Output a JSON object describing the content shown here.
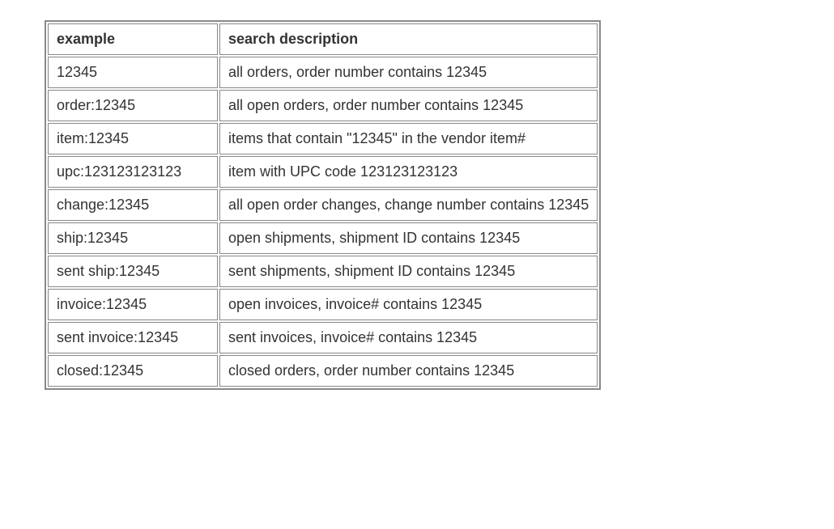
{
  "table": {
    "headers": {
      "example": "example",
      "description": "search description"
    },
    "rows": [
      {
        "example": "12345",
        "description": "all orders, order number contains 12345"
      },
      {
        "example": "order:12345",
        "description": "all open orders, order number contains 12345"
      },
      {
        "example": "item:12345",
        "description": "items that contain \"12345\" in the vendor item#"
      },
      {
        "example": "upc:123123123123",
        "description": "item with UPC code 123123123123"
      },
      {
        "example": "change:12345",
        "description": "all open order changes, change number contains 12345"
      },
      {
        "example": "ship:12345",
        "description": "open shipments, shipment ID contains 12345"
      },
      {
        "example": "sent ship:12345",
        "description": "sent shipments, shipment ID contains 12345"
      },
      {
        "example": "invoice:12345",
        "description": "open invoices, invoice# contains 12345"
      },
      {
        "example": "sent invoice:12345",
        "description": "sent invoices, invoice# contains 12345"
      },
      {
        "example": "closed:12345",
        "description": "closed orders, order number contains 12345"
      }
    ]
  }
}
